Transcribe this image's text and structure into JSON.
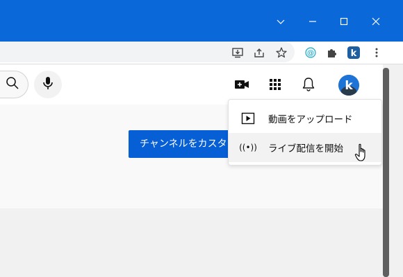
{
  "window": {
    "controls": [
      "chevron-down-icon",
      "minimize-icon",
      "maximize-icon",
      "close-icon"
    ],
    "titlebar_color": "#0b68d9"
  },
  "toolbar": {
    "icons": [
      "install-app-icon",
      "share-icon",
      "bookmark-star-icon",
      "extension-at-icon",
      "extensions-puzzle-icon",
      "profile-icon",
      "more-vert-icon"
    ]
  },
  "header": {
    "icons": [
      "search-icon",
      "microphone-icon",
      "create-video-icon",
      "apps-grid-icon",
      "notifications-bell-icon",
      "avatar"
    ]
  },
  "main": {
    "customize_button_label": "チャンネルをカスタマイズ",
    "accent_color": "#065fd4"
  },
  "create_menu": {
    "items": [
      {
        "label": "動画をアップロード",
        "icon": "upload-video-icon"
      },
      {
        "label": "ライブ配信を開始",
        "icon": "live-broadcast-icon",
        "icon_text": "((•))"
      }
    ]
  }
}
